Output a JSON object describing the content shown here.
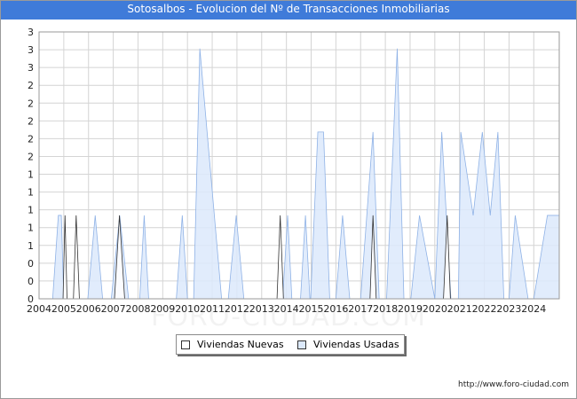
{
  "chart_data": {
    "type": "area",
    "title": "Sotosalbos - Evolucion del Nº de Transacciones Inmobiliarias",
    "x_labels": [
      "2004",
      "2005",
      "2006",
      "2007",
      "2008",
      "2009",
      "2010",
      "2011",
      "2012",
      "2013",
      "2014",
      "2015",
      "2016",
      "2017",
      "2018",
      "2019",
      "2020",
      "2021",
      "2022",
      "2023",
      "2024"
    ],
    "y_tick_labels": [
      "0",
      "0",
      "0",
      "1",
      "1",
      "1",
      "1",
      "1",
      "2",
      "2",
      "2",
      "2",
      "2",
      "3",
      "3",
      "3"
    ],
    "ylim": [
      0,
      3.2
    ],
    "grid": true,
    "legend_position": "bottom",
    "series": [
      {
        "name": "Viviendas Nuevas",
        "color": "#ffffff",
        "x": [
          2004.97,
          2005.05,
          2005.13,
          2005.39,
          2005.5,
          2005.63,
          2007.05,
          2007.25,
          2007.46,
          2013.62,
          2013.75,
          2013.88,
          2017.38,
          2017.5,
          2017.63,
          2020.35,
          2020.5,
          2020.63
        ],
        "values": [
          0,
          1,
          0,
          0,
          1,
          0,
          0,
          1,
          0,
          0,
          1,
          0,
          0,
          1,
          0,
          0,
          1,
          0
        ]
      },
      {
        "name": "Viviendas Usadas",
        "color": "#dce9fb",
        "x": [
          2004.55,
          2004.78,
          2004.9,
          2005.0,
          2005.97,
          2006.27,
          2006.57,
          2006.92,
          2007.26,
          2007.62,
          2008.07,
          2008.25,
          2008.43,
          2009.55,
          2009.79,
          2010.0,
          2010.25,
          2010.5,
          2011.38,
          2011.65,
          2011.97,
          2012.28,
          2013.85,
          2014.05,
          2014.22,
          2014.57,
          2014.77,
          2014.95,
          2014.98,
          2015.27,
          2015.5,
          2015.75,
          2016.0,
          2016.27,
          2016.56,
          2016.83,
          2017.0,
          2017.5,
          2017.75,
          2018.05,
          2018.48,
          2018.75,
          2019.03,
          2019.38,
          2020.0,
          2020.28,
          2020.65,
          2020.95,
          2021.05,
          2021.55,
          2021.92,
          2022.24,
          2022.55,
          2022.79,
          2023.0,
          2023.25,
          2023.77,
          2024.0,
          2024.55,
          2025.03
        ],
        "values": [
          0,
          1,
          1,
          0,
          0,
          1,
          0,
          0,
          1,
          0,
          0,
          1,
          0,
          0,
          1,
          0,
          0,
          3,
          0,
          0,
          1,
          0,
          0,
          1,
          0,
          0,
          1,
          0,
          0,
          2,
          2,
          0,
          0,
          1,
          0,
          0,
          0,
          2,
          0,
          0,
          3,
          0,
          0,
          1,
          0,
          2,
          0,
          0,
          2,
          1,
          2,
          1,
          2,
          0,
          0,
          1,
          0,
          0,
          1,
          1
        ]
      }
    ]
  },
  "legend": {
    "nuevas_label": "Viviendas Nuevas",
    "usadas_label": "Viviendas Usadas"
  },
  "watermark": "FORO-CIUDAD.COM",
  "footer": "http://www.foro-ciudad.com"
}
